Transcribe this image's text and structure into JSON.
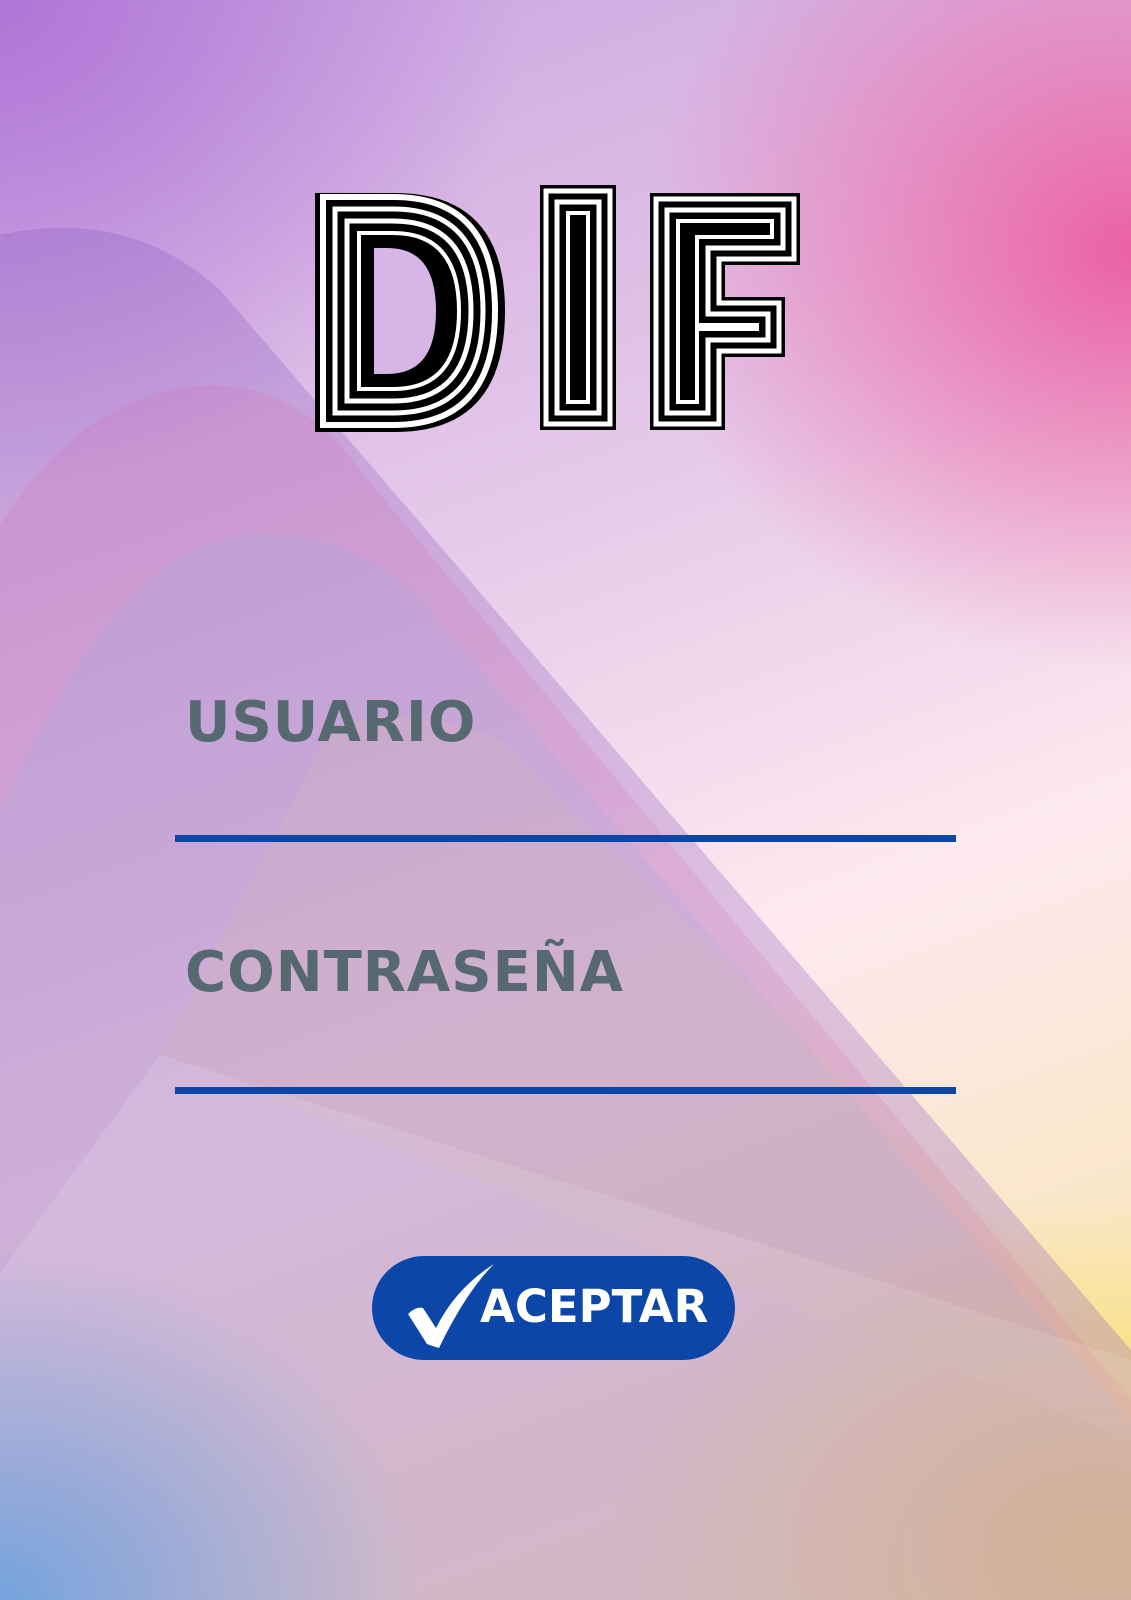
{
  "app": {
    "logo_text": "DIF"
  },
  "form": {
    "username_label": "USUARIO",
    "username_value": "",
    "password_label": "CONTRASEÑA",
    "password_value": "",
    "accept_label": "ACEPTAR"
  },
  "icons": {
    "accept_icon": "check-icon"
  },
  "colors": {
    "accent": "#0b46a8",
    "label_text": "#566870",
    "button_text": "#ffffff"
  }
}
